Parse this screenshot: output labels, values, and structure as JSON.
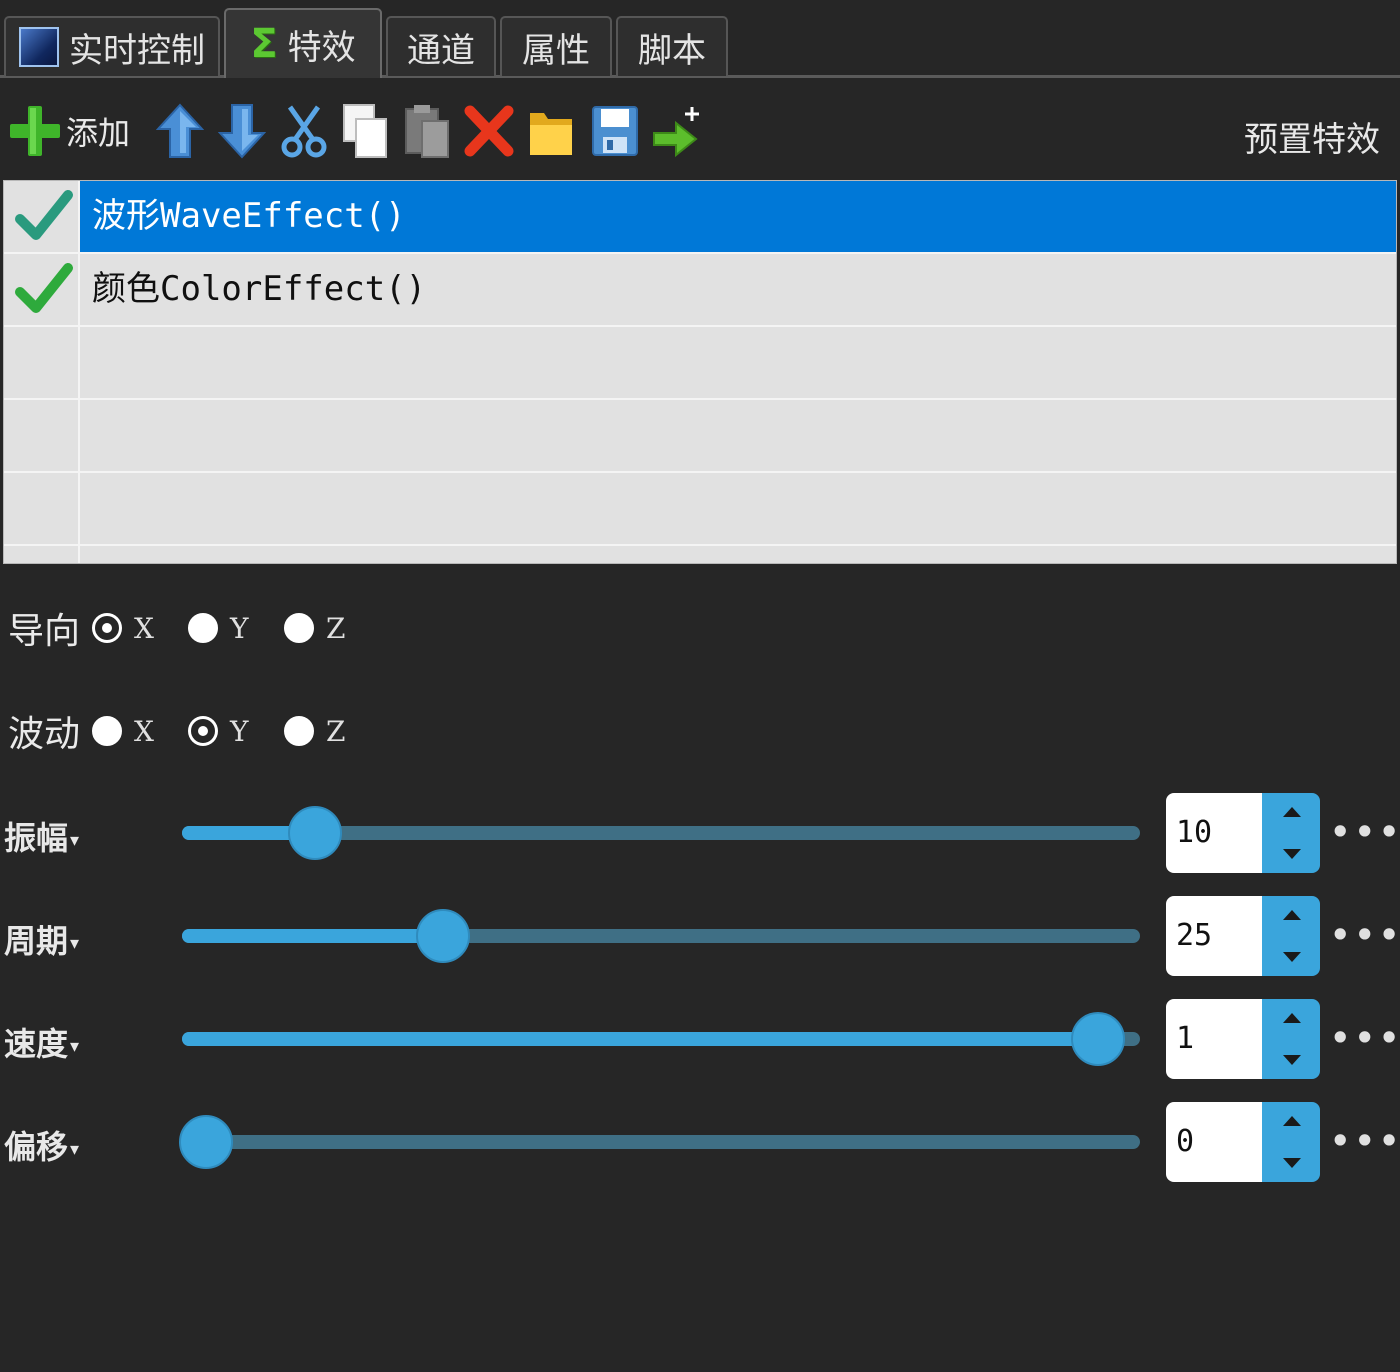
{
  "tabs": [
    {
      "label": "实时控制",
      "icon": "gradient-square-icon"
    },
    {
      "label": "特效",
      "icon": "sigma-icon",
      "active": true
    },
    {
      "label": "通道"
    },
    {
      "label": "属性"
    },
    {
      "label": "脚本"
    }
  ],
  "toolbar": {
    "add_label": "添加",
    "preset_label": "预置特效",
    "icons": [
      "add-icon",
      "move-up-icon",
      "move-down-icon",
      "cut-icon",
      "copy-icon",
      "paste-icon",
      "delete-icon",
      "open-folder-icon",
      "save-icon",
      "export-icon"
    ]
  },
  "effects": [
    {
      "name": "波形WaveEffect()",
      "enabled": true,
      "selected": true
    },
    {
      "name": "颜色ColorEffect()",
      "enabled": true,
      "selected": false
    }
  ],
  "orientation": {
    "label": "导向",
    "options": [
      "X",
      "Y",
      "Z"
    ],
    "selected": "X"
  },
  "wave_axis": {
    "label": "波动",
    "options": [
      "X",
      "Y",
      "Z"
    ],
    "selected": "Y"
  },
  "params": [
    {
      "label": "振幅",
      "value": "10",
      "fraction": 0.12,
      "more": "•••"
    },
    {
      "label": "周期",
      "value": "25",
      "fraction": 0.26,
      "more": "•••"
    },
    {
      "label": "速度",
      "value": "1",
      "fraction": 0.98,
      "more": "•••"
    },
    {
      "label": "偏移",
      "value": "0",
      "fraction": 0.0,
      "more": "•••"
    }
  ],
  "colors": {
    "accent": "#3aa5dc",
    "selection": "#0078d7",
    "background": "#262626",
    "list_background": "#e1e1e1"
  }
}
